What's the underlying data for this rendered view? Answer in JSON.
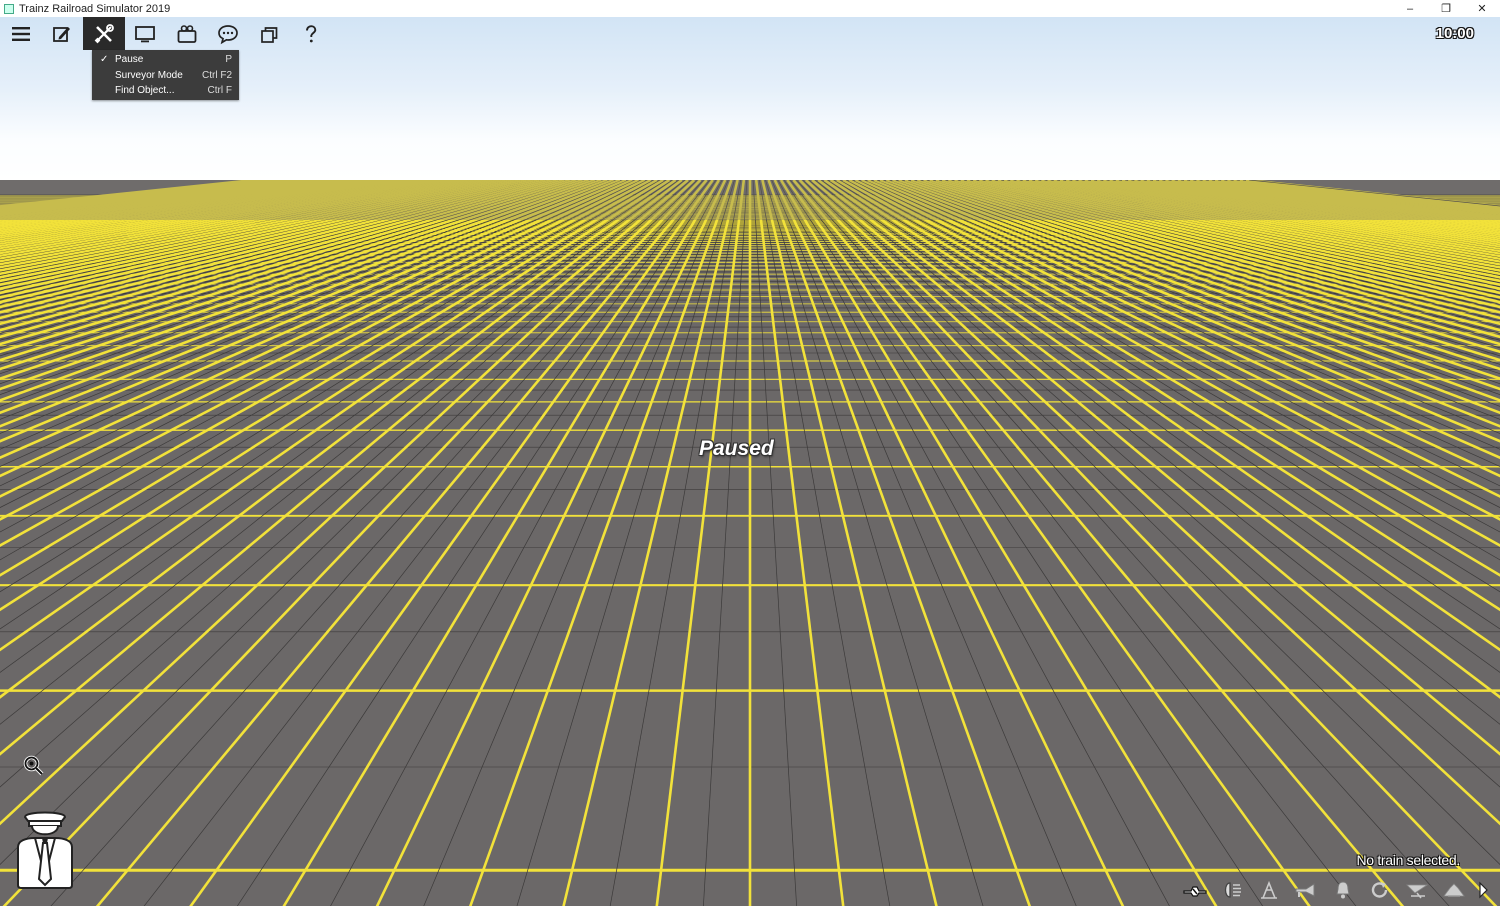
{
  "window": {
    "title": "Trainz Railroad Simulator 2019",
    "minimize_glyph": "–",
    "restore_glyph": "❐",
    "close_glyph": "✕"
  },
  "toolbar": {
    "items": [
      {
        "name": "main-menu-icon"
      },
      {
        "name": "edit-icon"
      },
      {
        "name": "tools-icon",
        "active": true
      },
      {
        "name": "display-icon"
      },
      {
        "name": "camera-icon"
      },
      {
        "name": "chat-icon"
      },
      {
        "name": "windows-icon"
      },
      {
        "name": "help-icon"
      }
    ]
  },
  "clock": "10:00",
  "tools_menu": {
    "items": [
      {
        "label": "Pause",
        "shortcut": "P",
        "checked": true
      },
      {
        "label": "Surveyor Mode",
        "shortcut": "Ctrl F2",
        "checked": false
      },
      {
        "label": "Find Object...",
        "shortcut": "Ctrl F",
        "checked": false
      }
    ]
  },
  "viewport": {
    "status_text": "Paused",
    "selection_text": "No train selected.",
    "grid_color": "#f2e23a",
    "ground_color": "#6b6868"
  },
  "bottom_controls": [
    "couple-icon",
    "lights-icon",
    "pantograph-icon",
    "horn-icon",
    "bell-icon",
    "reverse-icon",
    "sanding-icon",
    "smoke-icon",
    "expand-arrow-icon"
  ]
}
